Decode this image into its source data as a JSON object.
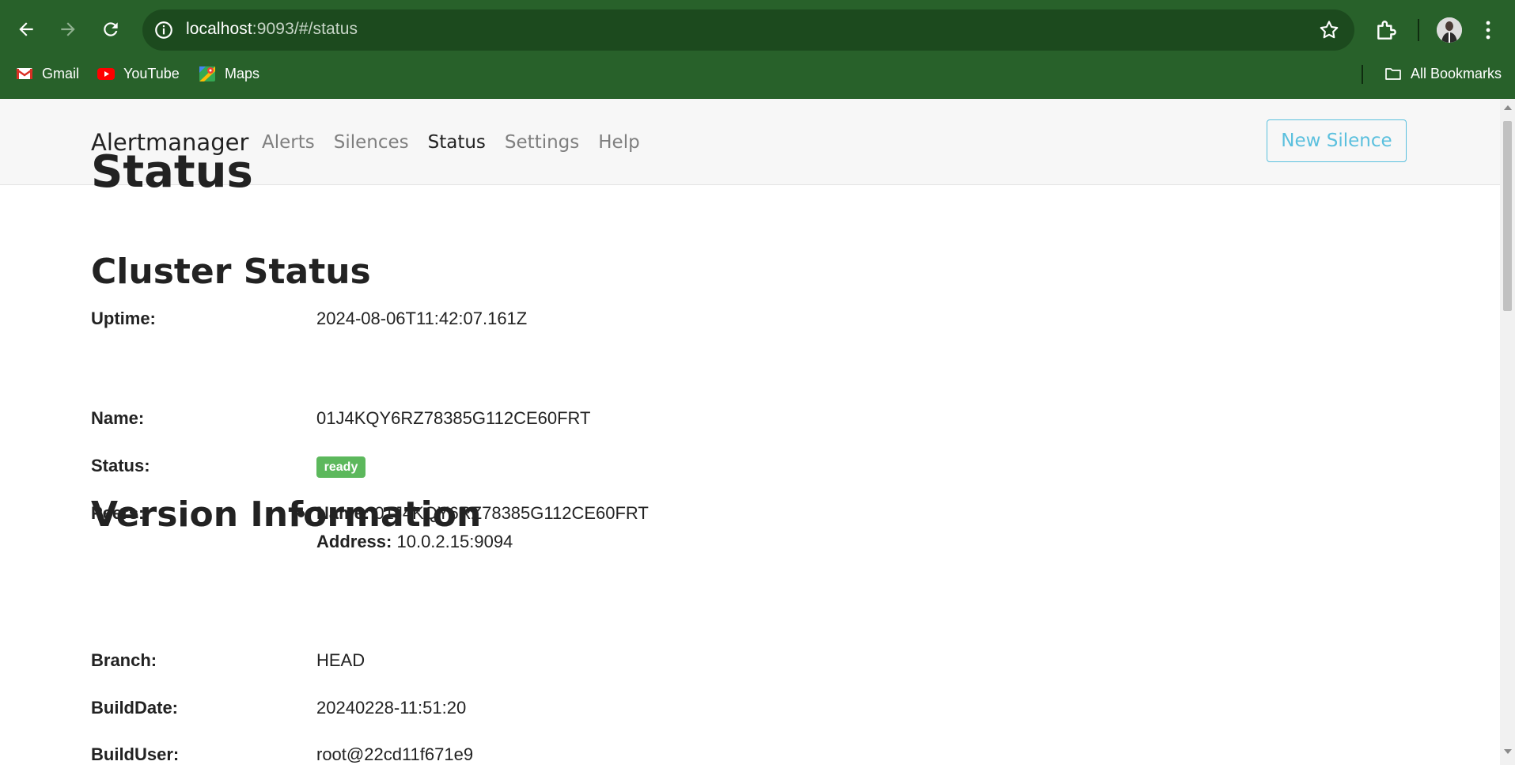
{
  "browser": {
    "url_host": "localhost",
    "url_rest": ":9093/#/status",
    "bookmarks": [
      {
        "label": "Gmail",
        "icon": "gmail-icon"
      },
      {
        "label": "YouTube",
        "icon": "youtube-icon"
      },
      {
        "label": "Maps",
        "icon": "maps-icon"
      }
    ],
    "all_bookmarks": "All Bookmarks"
  },
  "app": {
    "brand": "Alertmanager",
    "nav": [
      "Alerts",
      "Silences",
      "Status",
      "Settings",
      "Help"
    ],
    "active_nav": "Status",
    "new_silence": "New Silence"
  },
  "status": {
    "title": "Status",
    "uptime_label": "Uptime:",
    "uptime": "2024-08-06T11:42:07.161Z"
  },
  "cluster": {
    "title": "Cluster Status",
    "name_label": "Name:",
    "name": "01J4KQY6RZ78385G112CE60FRT",
    "status_label": "Status:",
    "status": "ready",
    "peers_label": "Peers:",
    "peer_name_label": "Name:",
    "peer_name": "01J4KQY6RZ78385G112CE60FRT",
    "peer_address_label": "Address:",
    "peer_address": "10.0.2.15:9094"
  },
  "version": {
    "title": "Version Information",
    "branch_label": "Branch:",
    "branch": "HEAD",
    "builddate_label": "BuildDate:",
    "builddate": "20240228-11:51:20",
    "builduser_label": "BuildUser:",
    "builduser": "root@22cd11f671e9"
  },
  "colors": {
    "chrome": "#28612a",
    "accent": "#5bc0de",
    "badge": "#5cb85c"
  }
}
